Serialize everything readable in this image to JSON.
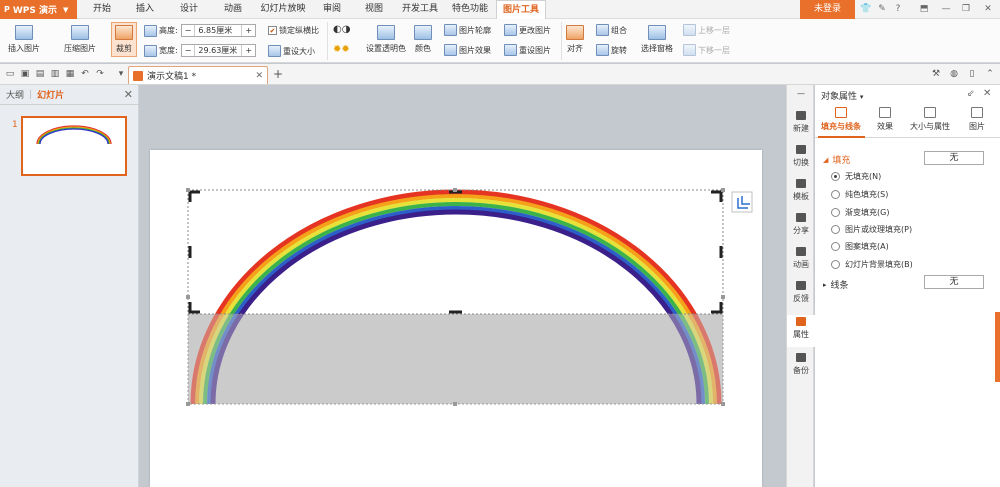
{
  "app": {
    "name": "WPS 演示",
    "login": "未登录"
  },
  "menu": [
    "开始",
    "插入",
    "设计",
    "动画",
    "幻灯片放映",
    "审阅",
    "视图",
    "开发工具",
    "特色功能",
    "图片工具"
  ],
  "ribbon": {
    "insert_picture": "插入图片",
    "compress": "压缩图片",
    "crop": "裁剪",
    "height_label": "高度:",
    "height_value": "6.85厘米",
    "width_label": "宽度:",
    "width_value": "29.63厘米",
    "lock_ratio": "锁定纵横比",
    "reset_size": "重设大小",
    "set_transparent": "设置透明色",
    "color": "颜色",
    "outline": "图片轮廓",
    "effect": "图片效果",
    "change": "更改图片",
    "reset": "重设图片",
    "align": "对齐",
    "group": "组合",
    "rotate": "旋转",
    "select_pane": "选择窗格",
    "bring_forward": "上移一层",
    "send_backward": "下移一层"
  },
  "document": {
    "tab": "演示文稿1 *"
  },
  "left_panel": {
    "tab_outline": "大纲",
    "tab_slides": "幻灯片",
    "slide_number": "1"
  },
  "sidebar": [
    "新建",
    "切换",
    "模板",
    "分享",
    "动画",
    "反馈",
    "属性",
    "备份"
  ],
  "panel": {
    "title": "对象属性",
    "tabs": [
      "填充与线条",
      "效果",
      "大小与属性",
      "图片"
    ],
    "fill_section": "填充",
    "fill_value": "无",
    "fill_options": [
      "无填充(N)",
      "纯色填充(S)",
      "渐变填充(G)",
      "图片或纹理填充(P)",
      "图案填充(A)",
      "幻灯片背景填充(B)"
    ],
    "line_section": "线条",
    "line_value": "无"
  }
}
